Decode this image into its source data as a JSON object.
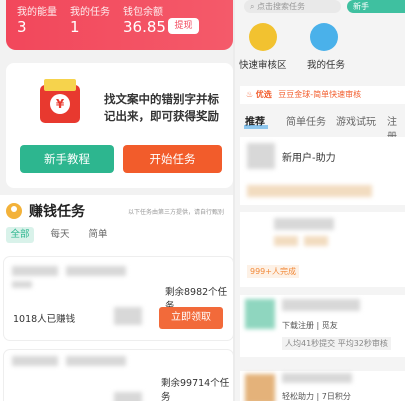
{
  "left": {
    "stats": [
      {
        "label": "我的能量",
        "value": "3"
      },
      {
        "label": "我的任务",
        "value": "1"
      },
      {
        "label": "钱包余额",
        "value": "36.85"
      }
    ],
    "withdraw_label": "提现",
    "promo_text": "找文案中的错别字并标记出来，即可获得奖励",
    "tutorial_button": "新手教程",
    "start_button": "开始任务",
    "section_title": "赚钱任务",
    "section_note": "以下任务由第三方提供，请自行甄别",
    "filter_tabs": [
      "全部",
      "每天",
      "简单"
    ],
    "cards": [
      {
        "sub": "每天",
        "remaining": "剩余8982个任务",
        "earned": "1018人已赚钱",
        "claim": "立即领取"
      },
      {
        "remaining": "剩余99714个任务"
      }
    ]
  },
  "right": {
    "search_placeholder": "点击搜索任务",
    "novice_label": "新手",
    "icons": [
      {
        "label": "快速审核区",
        "color": "#f2c230"
      },
      {
        "label": "我的任务",
        "color": "#4ab1ea"
      }
    ],
    "banner_tag": "优选",
    "banner_text": "豆豆金球-简单快速审核",
    "tabs": [
      "推荐",
      "简单任务",
      "游戏试玩",
      "注册"
    ],
    "card1_title": "新用户-助力",
    "card1_meta": "999+人完成",
    "card2_line1": "下载注册 | 觅友",
    "card2_line2": "人均41秒提交  平均32秒审核",
    "card3_line": "轻松助力 | 7日积分"
  }
}
